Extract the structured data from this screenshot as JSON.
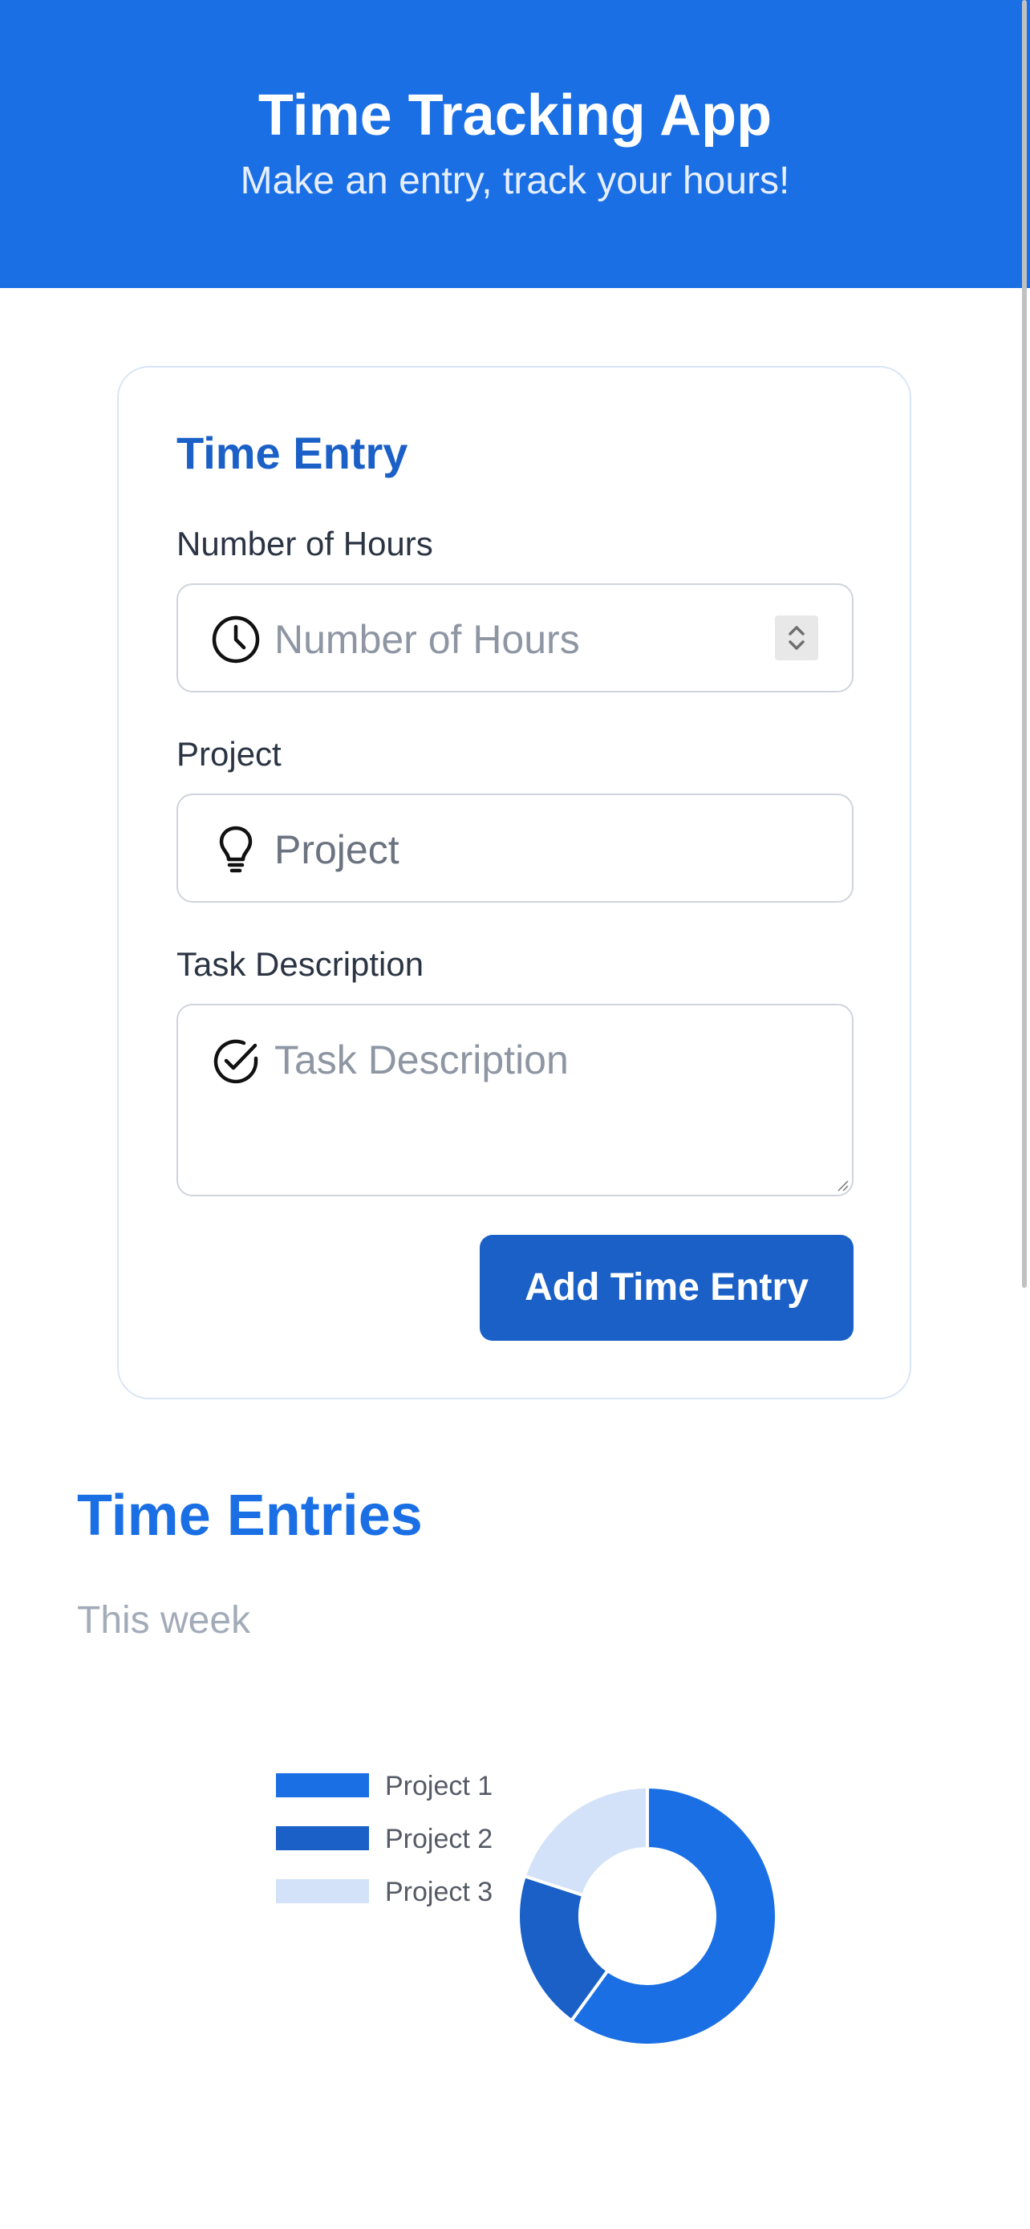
{
  "app": {
    "title": "Time Tracking App",
    "subtitle": "Make an entry, track your hours!"
  },
  "form": {
    "title": "Time Entry",
    "hours": {
      "label": "Number of Hours",
      "placeholder": "Number of Hours",
      "icon": "clock-icon"
    },
    "project": {
      "label": "Project",
      "placeholder": "Project",
      "icon": "lightbulb-icon"
    },
    "description": {
      "label": "Task Description",
      "placeholder": "Task Description",
      "icon": "check-circle-icon"
    },
    "submit_label": "Add Time Entry"
  },
  "entries": {
    "title": "Time Entries",
    "subtitle": "This week"
  },
  "colors": {
    "primary": "#1b6fe4",
    "primary_dark": "#1a60c7",
    "light": "#d3e2f8"
  },
  "chart_data": {
    "type": "pie",
    "variant": "doughnut",
    "legend_position": "left",
    "categories": [
      "Project 1",
      "Project 2",
      "Project 3"
    ],
    "values": [
      60,
      20,
      20
    ],
    "colors": [
      "#1b6fe4",
      "#1a60c7",
      "#d3e2f8"
    ]
  }
}
